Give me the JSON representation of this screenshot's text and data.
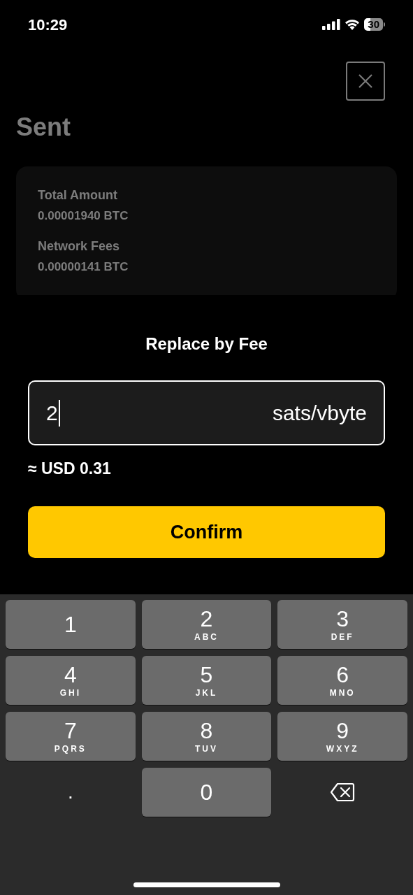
{
  "status_bar": {
    "time": "10:29",
    "battery": "30"
  },
  "header": {
    "title": "Sent"
  },
  "details": [
    {
      "label": "Total Amount",
      "value": "0.00001940 BTC"
    },
    {
      "label": "Network Fees",
      "value": "0.00000141 BTC"
    }
  ],
  "sheet": {
    "title": "Replace by Fee",
    "fee_field": {
      "value": "2",
      "unit": "sats/vbyte"
    },
    "estimate": "≈ USD 0.31",
    "confirm_button": "Confirm"
  },
  "keypad": [
    {
      "kind": "digit",
      "digit": "1"
    },
    {
      "kind": "digit",
      "digit": "2",
      "letters": "ABC"
    },
    {
      "kind": "digit",
      "digit": "3",
      "letters": "DEF"
    },
    {
      "kind": "digit",
      "digit": "4",
      "letters": "GHI"
    },
    {
      "kind": "digit",
      "digit": "5",
      "letters": "JKL"
    },
    {
      "kind": "digit",
      "digit": "6",
      "letters": "MNO"
    },
    {
      "kind": "digit",
      "digit": "7",
      "letters": "PQRS"
    },
    {
      "kind": "digit",
      "digit": "8",
      "letters": "TUV"
    },
    {
      "kind": "digit",
      "digit": "9",
      "letters": "WXYZ"
    },
    {
      "kind": "symbol",
      "digit": "."
    },
    {
      "kind": "digit",
      "digit": "0"
    },
    {
      "kind": "delete"
    }
  ]
}
